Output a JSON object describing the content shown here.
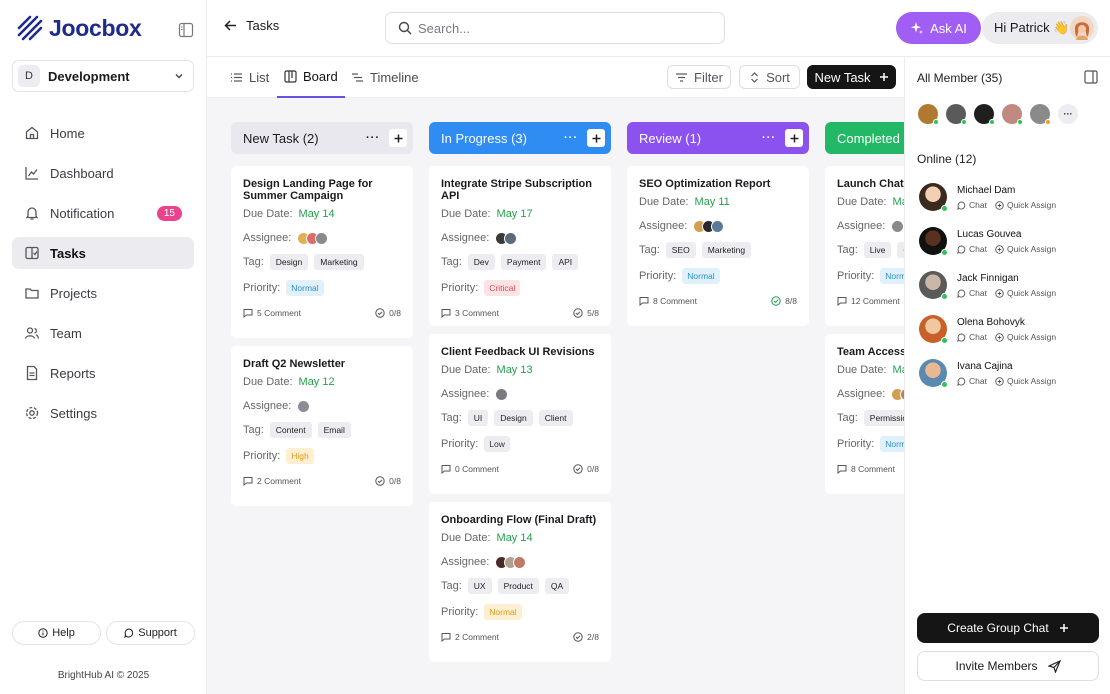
{
  "app": {
    "name": "Joocbox",
    "copyright": "BrightHub AI © 2025"
  },
  "workspace": {
    "badge": "D",
    "name": "Development"
  },
  "sidebar": {
    "items": [
      {
        "label": "Home",
        "icon": "home-icon"
      },
      {
        "label": "Dashboard",
        "icon": "chart-icon"
      },
      {
        "label": "Notification",
        "icon": "bell-icon",
        "badge": "15"
      },
      {
        "label": "Tasks",
        "icon": "tasks-icon",
        "active": true
      },
      {
        "label": "Projects",
        "icon": "folder-icon"
      },
      {
        "label": "Team",
        "icon": "team-icon"
      },
      {
        "label": "Reports",
        "icon": "report-icon"
      },
      {
        "label": "Settings",
        "icon": "gear-icon"
      }
    ],
    "help_label": "Help",
    "support_label": "Support"
  },
  "header": {
    "back_label": "Tasks",
    "search_placeholder": "Search...",
    "ask_ai_label": "Ask AI",
    "greeting": "Hi Patrick 👋"
  },
  "toolbar": {
    "tabs": [
      {
        "label": "List"
      },
      {
        "label": "Board",
        "active": true
      },
      {
        "label": "Timeline"
      }
    ],
    "filter_label": "Filter",
    "sort_label": "Sort",
    "new_task_label": "New Task"
  },
  "colors": {
    "accent": "#6b4fe0",
    "in_progress": "#2f8cf2",
    "review": "#8b52ef",
    "completed": "#22b866",
    "new_task_header": "#e8e8ee"
  },
  "board": {
    "due_label": "Due Date:",
    "assignee_label": "Assignee:",
    "tag_label": "Tag:",
    "priority_label": "Priority:",
    "columns": [
      {
        "name": "New Task (2)",
        "cards": [
          {
            "title": "Design Landing Page for Summer Campaign",
            "due": "May 14",
            "tags": [
              "Design",
              "Marketing"
            ],
            "priority": "Normal",
            "comments": "5 Comment",
            "progress": "0/8"
          },
          {
            "title": "Draft Q2 Newsletter",
            "due": "May 12",
            "tags": [
              "Content",
              "Email"
            ],
            "priority": "High",
            "comments": "2 Comment",
            "progress": "0/8"
          }
        ]
      },
      {
        "name": "In Progress (3)",
        "cards": [
          {
            "title": "Integrate Stripe Subscription API",
            "due": "May 17",
            "tags": [
              "Dev",
              "Payment",
              "API"
            ],
            "priority": "Critical",
            "comments": "3 Comment",
            "progress": "5/8"
          },
          {
            "title": "Client Feedback UI Revisions",
            "due": "May 13",
            "tags": [
              "UI",
              "Design",
              "Client"
            ],
            "priority": "Low",
            "comments": "0 Comment",
            "progress": "0/8"
          },
          {
            "title": "Onboarding Flow (Final Draft)",
            "due": "May 14",
            "tags": [
              "UX",
              "Product",
              "QA"
            ],
            "priority": "Normal",
            "comments": "2 Comment",
            "progress": "2/8"
          }
        ]
      },
      {
        "name": "Review (1)",
        "cards": [
          {
            "title": "SEO Optimization Report",
            "due": "May 11",
            "tags": [
              "SEO",
              "Marketing"
            ],
            "priority": "Normal",
            "comments": "8 Comment",
            "progress": "8/8"
          }
        ]
      },
      {
        "name": "Completed (",
        "cards": [
          {
            "title": "Launch Chat S",
            "due": "May",
            "tags": [
              "Live",
              "C"
            ],
            "priority": "Norm",
            "comments": "12 Comment",
            "progress": ""
          },
          {
            "title": "Team Access F",
            "due": "May",
            "tags": [
              "Permissio"
            ],
            "priority": "Norm",
            "comments": "8 Comment",
            "progress": ""
          }
        ]
      }
    ]
  },
  "right_panel": {
    "all_members_title": "All Member (35)",
    "online_title": "Online (12)",
    "chat_label": "Chat",
    "quick_assign_label": "Quick Assign",
    "members": [
      {
        "name": "Michael Dam"
      },
      {
        "name": "Lucas Gouvea"
      },
      {
        "name": "Jack Finnigan"
      },
      {
        "name": "Olena Bohovyk"
      },
      {
        "name": "Ivana Cajina"
      }
    ],
    "create_group_chat_label": "Create Group Chat",
    "invite_members_label": "Invite Members"
  }
}
